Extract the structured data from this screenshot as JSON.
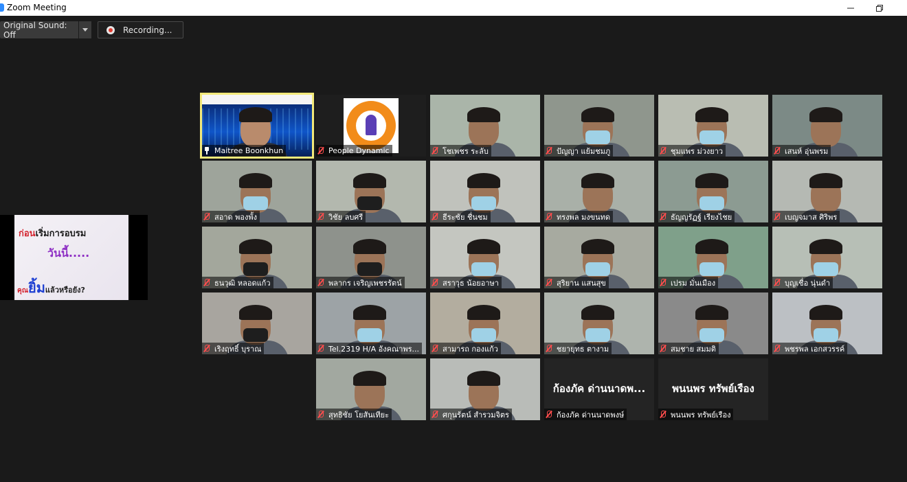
{
  "window": {
    "title": "Zoom Meeting"
  },
  "toolbar": {
    "original_sound_label": "Original Sound: Off",
    "recording_label": "Recording..."
  },
  "shared_content": {
    "line1_prefix": "ก่อน",
    "line1_rest": "เริ่มการอบรม",
    "line2": "วันนี้.....",
    "line3_prefix": "คุณ",
    "line3_emph": "ยิ้ม",
    "line3_rest": "แล้วหรือยัง?"
  },
  "participants": [
    {
      "name": "Maitree Boonkhun",
      "pinned": true,
      "highlighted": true
    },
    {
      "name": "People Dynamic",
      "logo": true
    },
    {
      "name": "โชเพชร ระลับ"
    },
    {
      "name": "ปัญญา แย้มชมภู"
    },
    {
      "name": "ชุมแพร ม่วงยาว"
    },
    {
      "name": "เสนห์ อุ่นพรม"
    },
    {
      "name": "สอาด พองพั้ง"
    },
    {
      "name": "วิชัย ลบศรี"
    },
    {
      "name": "ธีระชัย ชื่นชม"
    },
    {
      "name": "ทรงพล มงขนทด"
    },
    {
      "name": "ธัญญรัฏฐ์ เรียงไชย"
    },
    {
      "name": "เบญจมาส ศิริพร"
    },
    {
      "name": "ธนวุฒิ หลอดแก้ว"
    },
    {
      "name": "พลากร เจริญเพชรรัตน์"
    },
    {
      "name": "สราวุธ น้อยอาษา"
    },
    {
      "name": "สุริยาน แสนสุข"
    },
    {
      "name": "เปรม มั่นเมือง"
    },
    {
      "name": "บุญเชื่อ นุ่นดำ"
    },
    {
      "name": "เริงฤทธิ์ บุราณ"
    },
    {
      "name": "Tel.2319 H/A อังคณาพร..."
    },
    {
      "name": "สามารถ กองแก้ว"
    },
    {
      "name": "ชยายุทธ ตางาม"
    },
    {
      "name": "สมชาย สมมติ"
    },
    {
      "name": "พชรพล เอกสวรรค์"
    },
    {
      "name": "สุทธิชัย โยสันเทียะ"
    },
    {
      "name": "ศกุนรัตน์ สำรวมจิตร"
    },
    {
      "name": "ก้องภัค ด่านนาดพงษ์",
      "display_name": "ก้องภัค ด่านนาดพ...",
      "video_off": true
    },
    {
      "name": "พนนพร ทรัพย์เรือง",
      "display_name": "พนนพร ทรัพย์เรือง",
      "video_off": true
    }
  ]
}
